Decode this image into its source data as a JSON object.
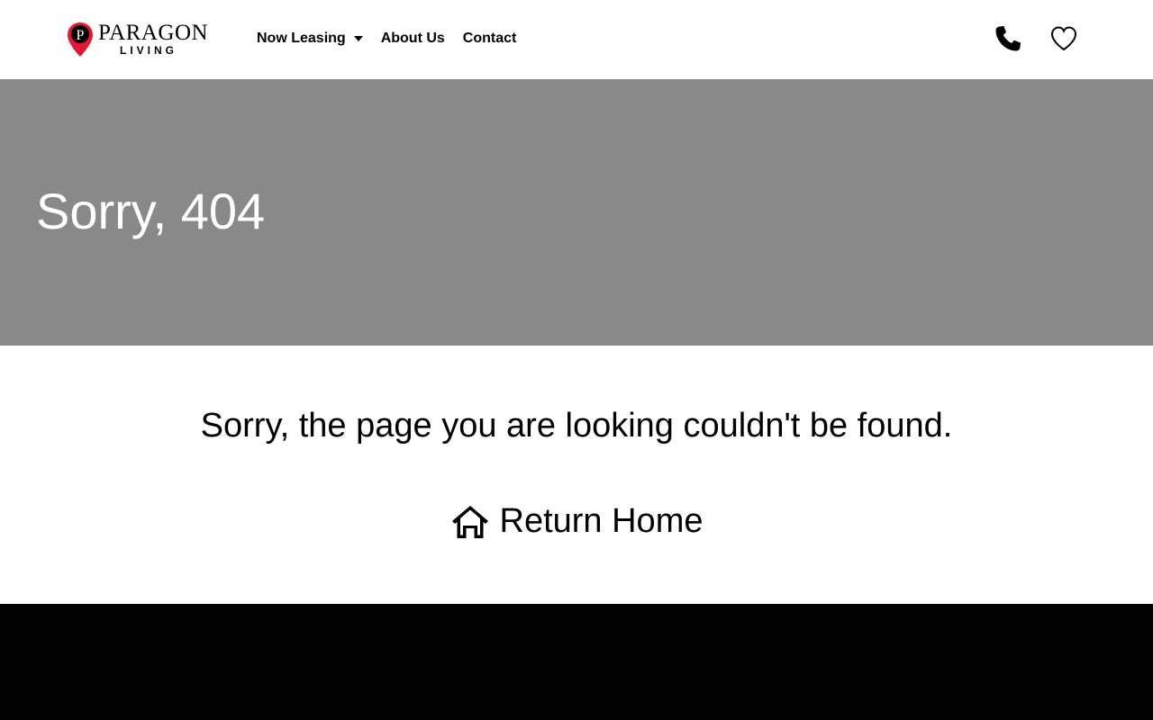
{
  "brand": {
    "name_top": "PARAGON",
    "name_bottom": "LIVING",
    "accent": "#e31837"
  },
  "nav": {
    "items": [
      {
        "label": "Now Leasing",
        "icon": "chevron-down-icon"
      },
      {
        "label": "About Us"
      },
      {
        "label": "Contact"
      }
    ]
  },
  "header_icons": {
    "phone": "phone-icon",
    "favorites": "heart-icon"
  },
  "hero": {
    "title": "Sorry, 404",
    "background": "#898989"
  },
  "main": {
    "message": "Sorry, the page you are looking couldn't be found.",
    "return_label": "Return Home",
    "return_icon": "home-icon"
  },
  "footer": {
    "background": "#030303"
  }
}
